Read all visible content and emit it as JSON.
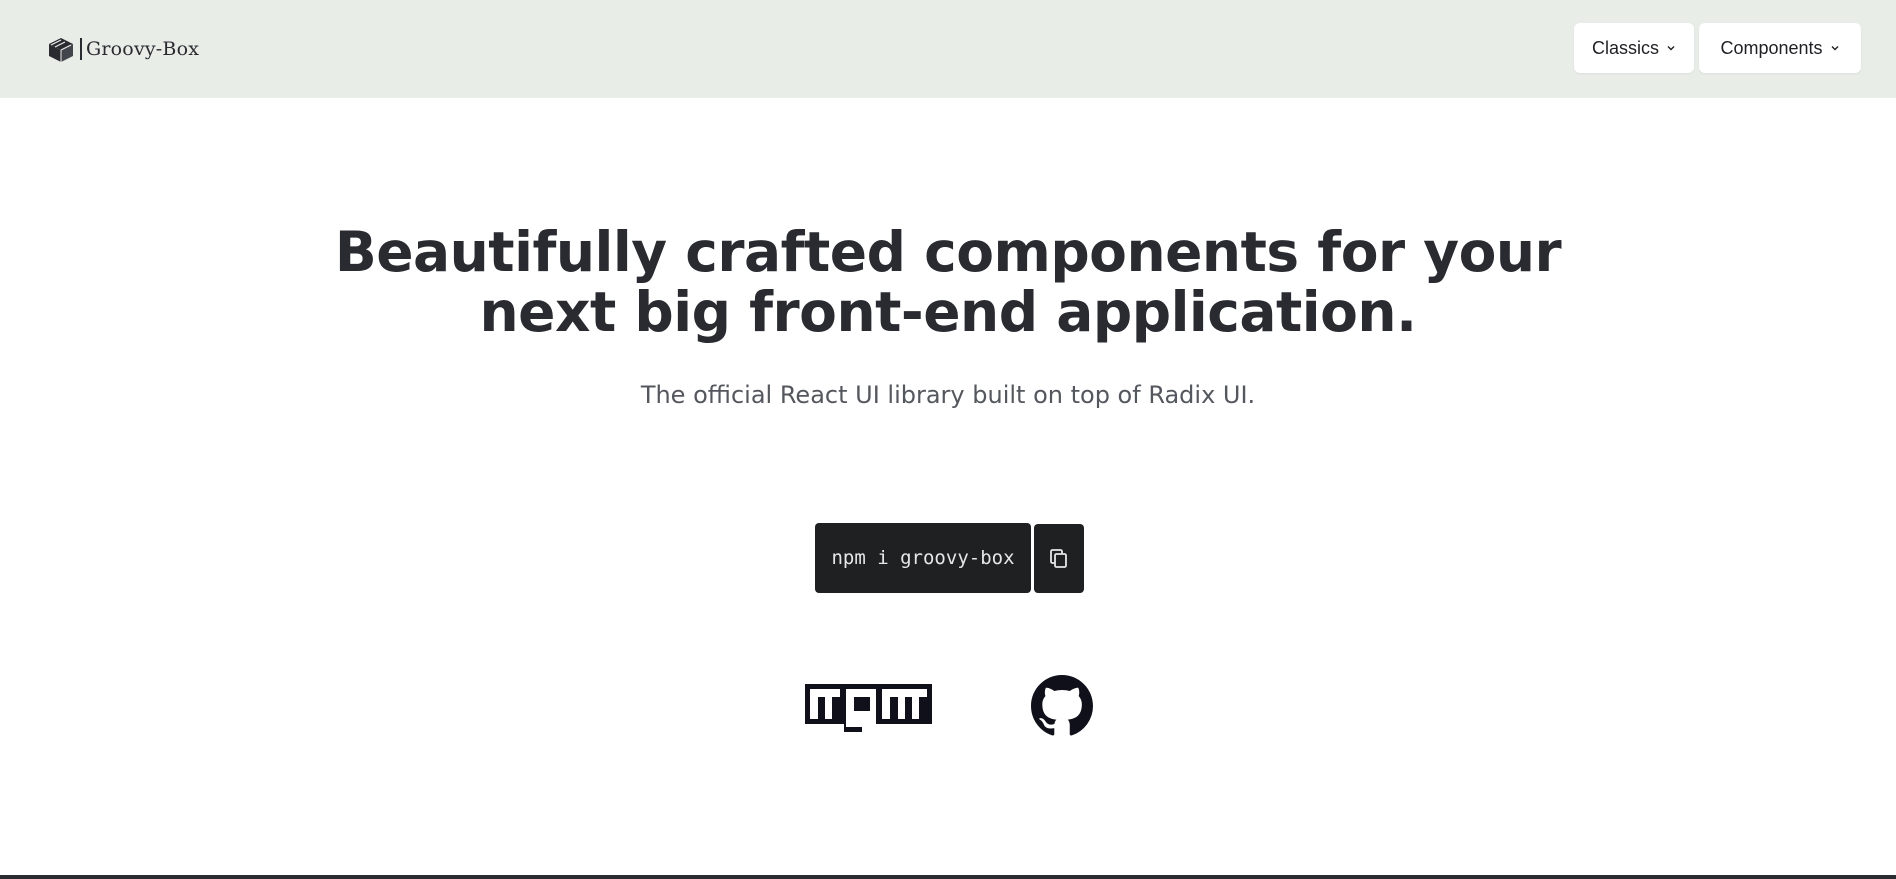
{
  "header": {
    "brand_name": "Groovy-Box",
    "brand_icon": "box-icon",
    "nav": [
      {
        "label": "Classics",
        "icon": "chevron-down-icon"
      },
      {
        "label": "Components",
        "icon": "chevron-down-icon"
      }
    ],
    "background_color": "#e8ede8"
  },
  "hero": {
    "title_line1": "Beautifully crafted components for your",
    "title_line2": "next big front-end application.",
    "subtitle": "The official React UI library built on top of Radix UI."
  },
  "install": {
    "command": "npm i groovy-box",
    "copy_icon": "copy-icon"
  },
  "links": {
    "npm_logo_text": "npm",
    "github_icon": "github-icon"
  }
}
